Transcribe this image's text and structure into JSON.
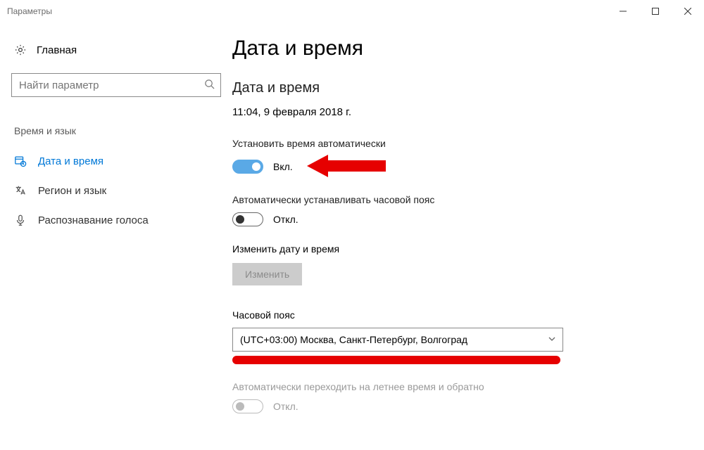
{
  "window": {
    "title": "Параметры"
  },
  "sidebar": {
    "home": "Главная",
    "search_placeholder": "Найти параметр",
    "group_title": "Время и язык",
    "items": [
      {
        "label": "Дата и время"
      },
      {
        "label": "Регион и язык"
      },
      {
        "label": "Распознавание голоса"
      }
    ]
  },
  "main": {
    "h1": "Дата и время",
    "h2": "Дата и время",
    "current_datetime": "11:04, 9 февраля 2018 г.",
    "auto_time": {
      "label": "Установить время автоматически",
      "state_text": "Вкл."
    },
    "auto_tz": {
      "label": "Автоматически устанавливать часовой пояс",
      "state_text": "Откл."
    },
    "change_dt": {
      "section_label": "Изменить дату и время",
      "button": "Изменить"
    },
    "timezone": {
      "label": "Часовой пояс",
      "selected": "(UTC+03:00) Москва, Санкт-Петербург, Волгоград"
    },
    "dst": {
      "label": "Автоматически переходить на летнее время и обратно",
      "state_text": "Откл."
    }
  }
}
